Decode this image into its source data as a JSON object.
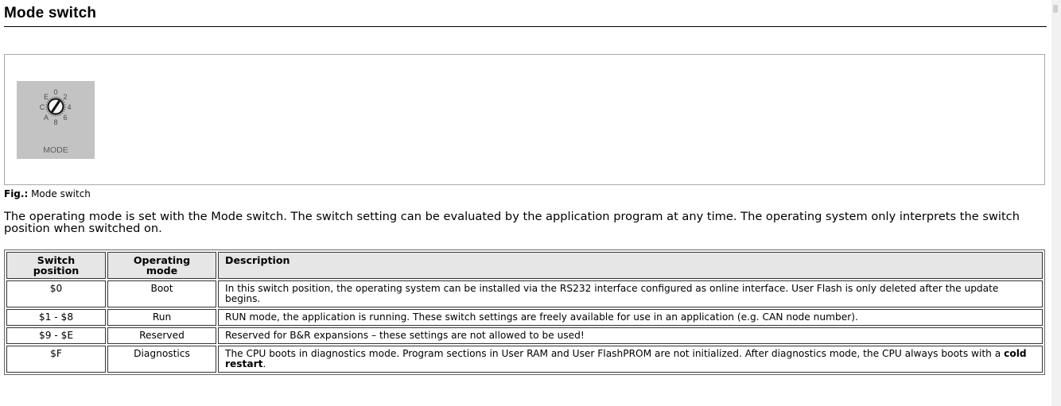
{
  "page": {
    "title": "Mode switch"
  },
  "figure": {
    "image_label": "MODE",
    "dial_digits": [
      "0",
      "2",
      "4",
      "6",
      "8",
      "A",
      "C",
      "E"
    ],
    "caption_prefix": "Fig.:",
    "caption_text": " Mode switch"
  },
  "intro": "The operating mode is set with the Mode switch. The switch setting can be evaluated by the application program at any time. The operating system only interprets the switch position when switched on.",
  "table": {
    "headers": {
      "switch_line1": "Switch",
      "switch_line2": "position",
      "mode_line1": "Operating",
      "mode_line2": "mode",
      "description": "Description"
    },
    "rows": [
      {
        "position": "$0",
        "mode": "Boot",
        "description": "In this switch position, the operating system can be installed via the RS232 interface configured as online interface. User Flash is only deleted after the update begins."
      },
      {
        "position": "$1 - $8",
        "mode": "Run",
        "description": "RUN mode, the application is running. These switch settings are freely available for use in an application (e.g. CAN node number)."
      },
      {
        "position": "$9 - $E",
        "mode": "Reserved",
        "description": "Reserved for B&R expansions – these settings are not allowed to be used!"
      },
      {
        "position": "$F",
        "mode": "Diagnostics",
        "description_main": "The CPU boots in diagnostics mode. Program sections in User RAM and User FlashPROM are not initialized. After diagnostics mode, the CPU always boots with a ",
        "description_bold": "cold restart",
        "description_end": "."
      }
    ]
  }
}
